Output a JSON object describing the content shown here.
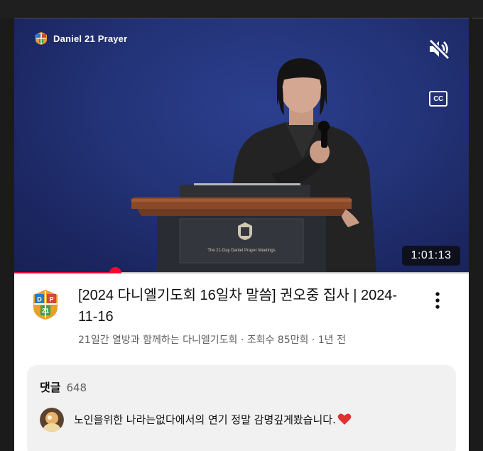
{
  "video": {
    "channel_watermark": "Daniel 21 Prayer",
    "podium_text": "The 21-Day Daniel Prayer Meetings",
    "cc_label": "CC",
    "duration": "1:01:13",
    "progress_fraction": 0.222,
    "icons": [
      "daniel21-logo-icon",
      "mute-icon",
      "cc-icon"
    ]
  },
  "info": {
    "title": "[2024 다니엘기도회 16일차 말씀] 권오중 집사 | 2024-11-16",
    "meta": "21일간 열방과 함께하는 다니엘기도회 · 조회수 85만회 · 1년 전",
    "icons": [
      "channel-avatar-icon",
      "more-options-icon"
    ]
  },
  "comments": {
    "label": "댓글",
    "count": "648",
    "top_comment": "노인을위한 나라는없다에서의 연기 정말 감명깊게봤습니다.",
    "icons": [
      "commenter-avatar-icon",
      "red-heart-icon"
    ]
  },
  "colors": {
    "accent": "#ff0033",
    "video_bg": "#1f2b6b",
    "comment_bg": "#f1f1f1"
  }
}
